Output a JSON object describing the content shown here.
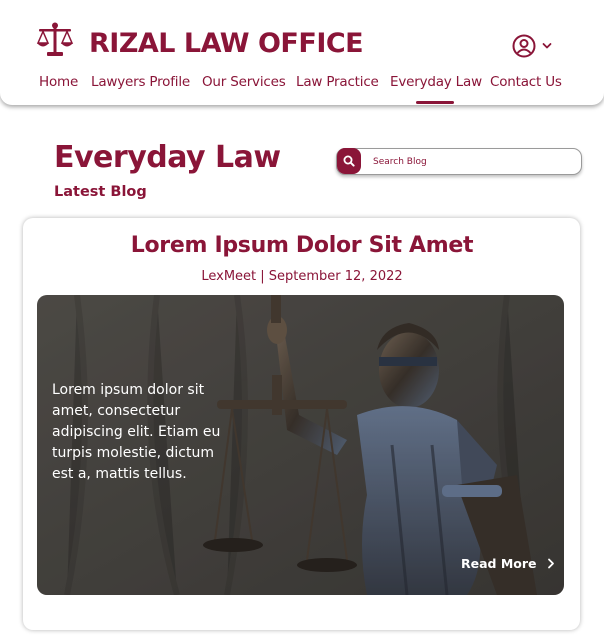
{
  "brand": {
    "name": "RIZAL LAW OFFICE",
    "logo_icon": "scales-of-justice-icon"
  },
  "account": {
    "icon": "user-circle-icon",
    "chevron": "chevron-down-icon"
  },
  "nav": {
    "items": [
      {
        "label": "Home"
      },
      {
        "label": "Lawyers Profile"
      },
      {
        "label": "Our Services"
      },
      {
        "label": "Law Practice"
      },
      {
        "label": "Everyday Law",
        "active": true
      },
      {
        "label": "Contact Us"
      }
    ]
  },
  "page": {
    "title": "Everyday Law",
    "subtitle": "Latest Blog"
  },
  "search": {
    "placeholder": "Search Blog",
    "icon": "search-icon"
  },
  "post": {
    "title": "Lorem Ipsum Dolor Sit Amet",
    "meta": "LexMeet | September 12, 2022",
    "excerpt": "Lorem ipsum dolor sit amet, consectetur adipiscing elit. Etiam eu turpis molestie, dictum est a, mattis tellus.",
    "read_more": "Read More",
    "read_more_icon": "chevron-right-icon",
    "image": "lady-justice-statue-photo"
  },
  "colors": {
    "brand": "#8a1538",
    "white": "#ffffff"
  }
}
